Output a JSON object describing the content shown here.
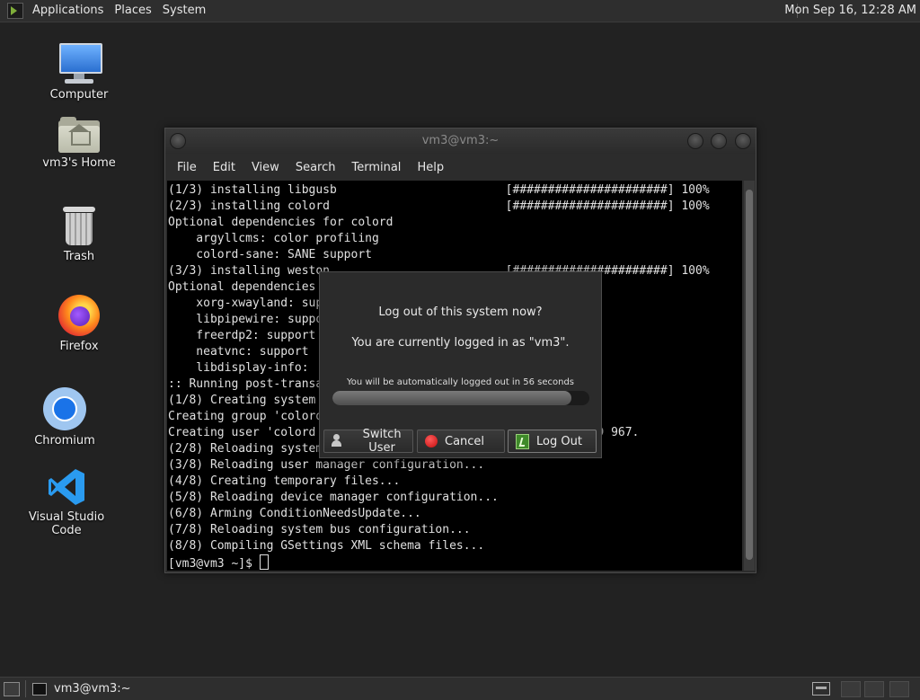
{
  "top_panel": {
    "menus": [
      "Applications",
      "Places",
      "System"
    ],
    "clock": "Mon Sep 16, 12:28 AM"
  },
  "desktop_icons": [
    {
      "label": "Computer",
      "icon": "computer-icon"
    },
    {
      "label": "vm3's Home",
      "icon": "home-folder-icon"
    },
    {
      "label": "Trash",
      "icon": "trash-icon"
    },
    {
      "label": "Firefox",
      "icon": "firefox-icon"
    },
    {
      "label": "Chromium",
      "icon": "chromium-icon"
    },
    {
      "label": "Visual Studio Code",
      "icon": "vscode-icon"
    }
  ],
  "terminal": {
    "title": "vm3@vm3:~",
    "menu": [
      "File",
      "Edit",
      "View",
      "Search",
      "Terminal",
      "Help"
    ],
    "lines": [
      "(1/3) installing libgusb                        [######################] 100%",
      "(2/3) installing colord                         [######################] 100%",
      "Optional dependencies for colord",
      "    argyllcms: color profiling",
      "    colord-sane: SANE support",
      "(3/3) installing weston                         [######################] 100%",
      "Optional dependencies",
      "    xorg-xwayland: sup",
      "    libpipewire: suppo",
      "    freerdp2: support",
      "    neatvnc: support ",
      "    libdisplay-info: ",
      ":: Running post-transa",
      "(1/8) Creating system",
      "Creating group 'colord",
      "Creating user 'colord                                  and GID 967.",
      "(2/8) Reloading system",
      "(3/8) Reloading user manager configuration...",
      "(4/8) Creating temporary files...",
      "(5/8) Reloading device manager configuration...",
      "(6/8) Arming ConditionNeedsUpdate...",
      "(7/8) Reloading system bus configuration...",
      "(8/8) Compiling GSettings XML schema files..."
    ],
    "prompt": "[vm3@vm3 ~]$ "
  },
  "logout_dialog": {
    "title": "Log out of this system now?",
    "message": "You are currently logged in as \"vm3\".",
    "auto_text": "You will be automatically logged out in 56 seconds",
    "progress_fraction": 0.93,
    "buttons": {
      "switch_user": "Switch User",
      "cancel": "Cancel",
      "log_out": "Log Out"
    }
  },
  "bottom_panel": {
    "task_label": "vm3@vm3:~"
  }
}
